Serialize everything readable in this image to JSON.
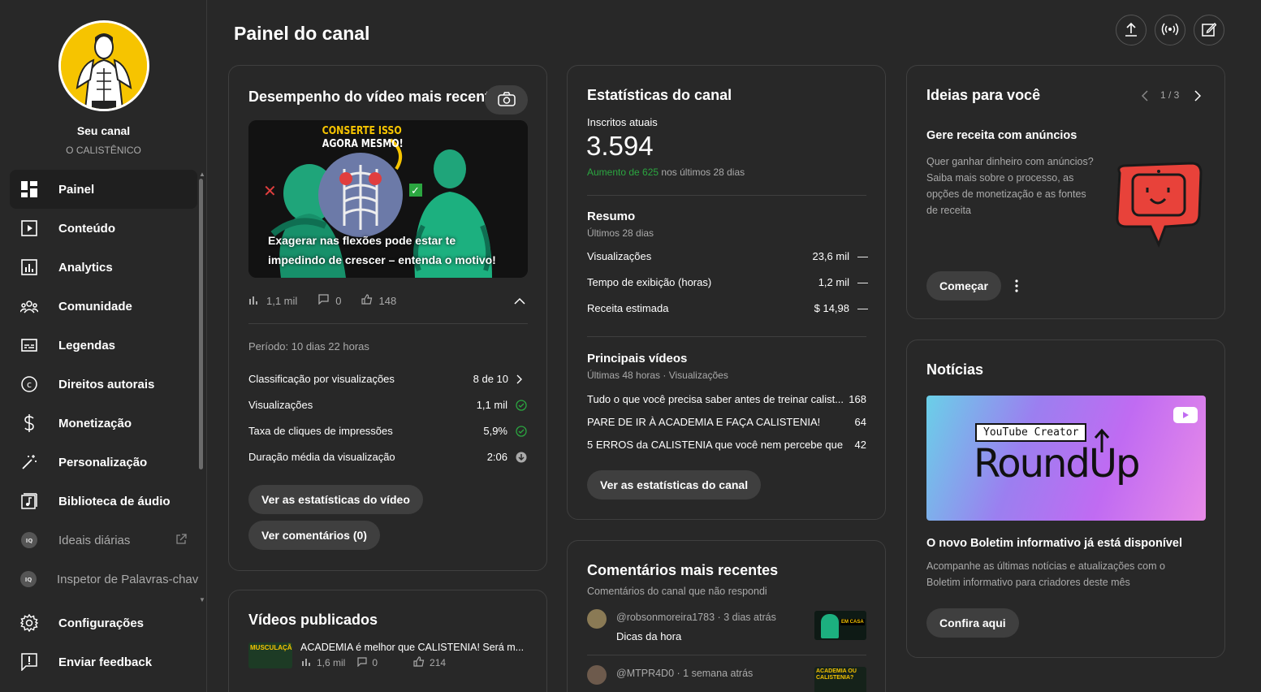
{
  "sidebar": {
    "channel_title": "Seu canal",
    "channel_name": "O CALISTÊNICO",
    "items": [
      {
        "label": "Painel",
        "icon": "dashboard-icon"
      },
      {
        "label": "Conteúdo",
        "icon": "content-icon"
      },
      {
        "label": "Analytics",
        "icon": "analytics-icon"
      },
      {
        "label": "Comunidade",
        "icon": "community-icon"
      },
      {
        "label": "Legendas",
        "icon": "subtitles-icon"
      },
      {
        "label": "Direitos autorais",
        "icon": "copyright-icon"
      },
      {
        "label": "Monetização",
        "icon": "dollar-icon"
      },
      {
        "label": "Personalização",
        "icon": "magic-wand-icon"
      },
      {
        "label": "Biblioteca de áudio",
        "icon": "audio-library-icon"
      },
      {
        "label": "Ideais diárias",
        "icon": "extension-icon"
      },
      {
        "label": "Inspetor de Palavras-chav",
        "icon": "extension-icon"
      }
    ],
    "bottom": [
      {
        "label": "Configurações",
        "icon": "gear-icon"
      },
      {
        "label": "Enviar feedback",
        "icon": "feedback-icon"
      }
    ]
  },
  "header": {
    "title": "Painel do canal"
  },
  "latest_video": {
    "title": "Desempenho do vídeo mais recente",
    "thumb_overlay_top_1": "CONSERTE ISSO",
    "thumb_overlay_top_2": "AGORA MESMO!",
    "video_title": "Exagerar nas flexões pode estar te impedindo de crescer – entenda o motivo!",
    "views": "1,1 mil",
    "comments": "0",
    "likes": "148",
    "period": "Período: 10 dias 22 horas",
    "metrics": [
      {
        "label": "Classificação por visualizações",
        "value": "8 de 10"
      },
      {
        "label": "Visualizações",
        "value": "1,1 mil"
      },
      {
        "label": "Taxa de cliques de impressões",
        "value": "5,9%"
      },
      {
        "label": "Duração média da visualização",
        "value": "2:06"
      }
    ],
    "btn_stats": "Ver as estatísticas do vídeo",
    "btn_comments": "Ver comentários (0)"
  },
  "published": {
    "title": "Vídeos publicados",
    "video_title": "ACADEMIA é melhor que CALISTENIA! Será m...",
    "thumb_text": "MUSCULAÇÃO",
    "views": "1,6 mil",
    "comments": "0",
    "likes": "214"
  },
  "channel_stats": {
    "title": "Estatísticas do canal",
    "subs_label": "Inscritos atuais",
    "subs_value": "3.594",
    "subs_growth": "Aumento de 625",
    "subs_growth_suffix": "nos últimos 28 dias",
    "summary_title": "Resumo",
    "summary_sub": "Últimos 28 dias",
    "summary": [
      {
        "label": "Visualizações",
        "value": "23,6 mil",
        "trend": "—"
      },
      {
        "label": "Tempo de exibição (horas)",
        "value": "1,2 mil",
        "trend": "—"
      },
      {
        "label": "Receita estimada",
        "value": "$ 14,98",
        "trend": "—"
      }
    ],
    "top_title": "Principais vídeos",
    "top_sub": "Últimas 48 horas · Visualizações",
    "top_videos": [
      {
        "title": "Tudo o que você precisa saber antes de treinar calist...",
        "views": "168"
      },
      {
        "title": "PARE DE IR À ACADEMIA E FAÇA CALISTENIA!",
        "views": "64"
      },
      {
        "title": "5 ERROS da CALISTENIA que você nem percebe que ...",
        "views": "42"
      }
    ],
    "btn": "Ver as estatísticas do canal"
  },
  "comments": {
    "title": "Comentários mais recentes",
    "sub": "Comentários do canal que não respondi",
    "items": [
      {
        "author_time": "@robsonmoreira1783 · 3 dias atrás",
        "text": "Dicas da hora",
        "thumb_text": "EM CASA"
      },
      {
        "author_time": "@MTPR4D0 · 1 semana atrás",
        "text": "",
        "thumb_text": "ACADEMIA OU CALISTENIA?"
      }
    ]
  },
  "ideas": {
    "title": "Ideias para você",
    "pager": "1 / 3",
    "heading": "Gere receita com anúncios",
    "body": "Quer ganhar dinheiro com anúncios? Saiba mais sobre o processo, as opções de monetização e as fontes de receita",
    "btn": "Começar"
  },
  "news": {
    "title": "Notícias",
    "img_label": "YouTube Creator",
    "img_big": "RoundUp",
    "headline": "O novo Boletim informativo já está disponível",
    "body": "Acompanhe as últimas notícias e atualizações com o Boletim informativo para criadores deste mês",
    "btn": "Confira aqui"
  },
  "colors": {
    "accent_green": "#2ba640",
    "yellow": "#f6c400",
    "card_border": "#3f3f3f"
  }
}
